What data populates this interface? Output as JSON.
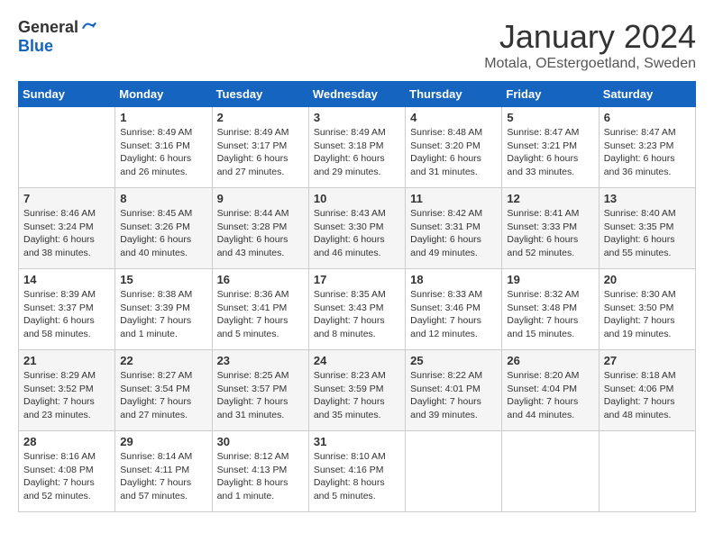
{
  "header": {
    "logo_general": "General",
    "logo_blue": "Blue",
    "month": "January 2024",
    "location": "Motala, OEstergoetland, Sweden"
  },
  "weekdays": [
    "Sunday",
    "Monday",
    "Tuesday",
    "Wednesday",
    "Thursday",
    "Friday",
    "Saturday"
  ],
  "weeks": [
    [
      {
        "day": "",
        "info": ""
      },
      {
        "day": "1",
        "info": "Sunrise: 8:49 AM\nSunset: 3:16 PM\nDaylight: 6 hours\nand 26 minutes."
      },
      {
        "day": "2",
        "info": "Sunrise: 8:49 AM\nSunset: 3:17 PM\nDaylight: 6 hours\nand 27 minutes."
      },
      {
        "day": "3",
        "info": "Sunrise: 8:49 AM\nSunset: 3:18 PM\nDaylight: 6 hours\nand 29 minutes."
      },
      {
        "day": "4",
        "info": "Sunrise: 8:48 AM\nSunset: 3:20 PM\nDaylight: 6 hours\nand 31 minutes."
      },
      {
        "day": "5",
        "info": "Sunrise: 8:47 AM\nSunset: 3:21 PM\nDaylight: 6 hours\nand 33 minutes."
      },
      {
        "day": "6",
        "info": "Sunrise: 8:47 AM\nSunset: 3:23 PM\nDaylight: 6 hours\nand 36 minutes."
      }
    ],
    [
      {
        "day": "7",
        "info": "Sunrise: 8:46 AM\nSunset: 3:24 PM\nDaylight: 6 hours\nand 38 minutes."
      },
      {
        "day": "8",
        "info": "Sunrise: 8:45 AM\nSunset: 3:26 PM\nDaylight: 6 hours\nand 40 minutes."
      },
      {
        "day": "9",
        "info": "Sunrise: 8:44 AM\nSunset: 3:28 PM\nDaylight: 6 hours\nand 43 minutes."
      },
      {
        "day": "10",
        "info": "Sunrise: 8:43 AM\nSunset: 3:30 PM\nDaylight: 6 hours\nand 46 minutes."
      },
      {
        "day": "11",
        "info": "Sunrise: 8:42 AM\nSunset: 3:31 PM\nDaylight: 6 hours\nand 49 minutes."
      },
      {
        "day": "12",
        "info": "Sunrise: 8:41 AM\nSunset: 3:33 PM\nDaylight: 6 hours\nand 52 minutes."
      },
      {
        "day": "13",
        "info": "Sunrise: 8:40 AM\nSunset: 3:35 PM\nDaylight: 6 hours\nand 55 minutes."
      }
    ],
    [
      {
        "day": "14",
        "info": "Sunrise: 8:39 AM\nSunset: 3:37 PM\nDaylight: 6 hours\nand 58 minutes."
      },
      {
        "day": "15",
        "info": "Sunrise: 8:38 AM\nSunset: 3:39 PM\nDaylight: 7 hours\nand 1 minute."
      },
      {
        "day": "16",
        "info": "Sunrise: 8:36 AM\nSunset: 3:41 PM\nDaylight: 7 hours\nand 5 minutes."
      },
      {
        "day": "17",
        "info": "Sunrise: 8:35 AM\nSunset: 3:43 PM\nDaylight: 7 hours\nand 8 minutes."
      },
      {
        "day": "18",
        "info": "Sunrise: 8:33 AM\nSunset: 3:46 PM\nDaylight: 7 hours\nand 12 minutes."
      },
      {
        "day": "19",
        "info": "Sunrise: 8:32 AM\nSunset: 3:48 PM\nDaylight: 7 hours\nand 15 minutes."
      },
      {
        "day": "20",
        "info": "Sunrise: 8:30 AM\nSunset: 3:50 PM\nDaylight: 7 hours\nand 19 minutes."
      }
    ],
    [
      {
        "day": "21",
        "info": "Sunrise: 8:29 AM\nSunset: 3:52 PM\nDaylight: 7 hours\nand 23 minutes."
      },
      {
        "day": "22",
        "info": "Sunrise: 8:27 AM\nSunset: 3:54 PM\nDaylight: 7 hours\nand 27 minutes."
      },
      {
        "day": "23",
        "info": "Sunrise: 8:25 AM\nSunset: 3:57 PM\nDaylight: 7 hours\nand 31 minutes."
      },
      {
        "day": "24",
        "info": "Sunrise: 8:23 AM\nSunset: 3:59 PM\nDaylight: 7 hours\nand 35 minutes."
      },
      {
        "day": "25",
        "info": "Sunrise: 8:22 AM\nSunset: 4:01 PM\nDaylight: 7 hours\nand 39 minutes."
      },
      {
        "day": "26",
        "info": "Sunrise: 8:20 AM\nSunset: 4:04 PM\nDaylight: 7 hours\nand 44 minutes."
      },
      {
        "day": "27",
        "info": "Sunrise: 8:18 AM\nSunset: 4:06 PM\nDaylight: 7 hours\nand 48 minutes."
      }
    ],
    [
      {
        "day": "28",
        "info": "Sunrise: 8:16 AM\nSunset: 4:08 PM\nDaylight: 7 hours\nand 52 minutes."
      },
      {
        "day": "29",
        "info": "Sunrise: 8:14 AM\nSunset: 4:11 PM\nDaylight: 7 hours\nand 57 minutes."
      },
      {
        "day": "30",
        "info": "Sunrise: 8:12 AM\nSunset: 4:13 PM\nDaylight: 8 hours\nand 1 minute."
      },
      {
        "day": "31",
        "info": "Sunrise: 8:10 AM\nSunset: 4:16 PM\nDaylight: 8 hours\nand 5 minutes."
      },
      {
        "day": "",
        "info": ""
      },
      {
        "day": "",
        "info": ""
      },
      {
        "day": "",
        "info": ""
      }
    ]
  ]
}
